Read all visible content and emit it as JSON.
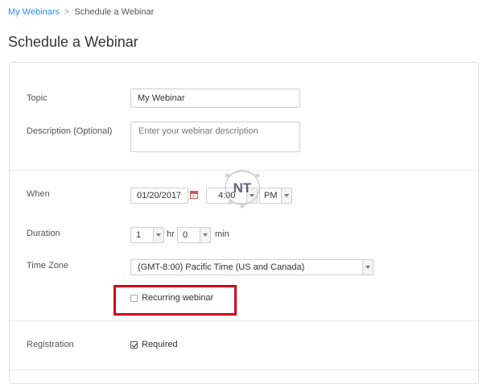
{
  "breadcrumb": {
    "parent": "My Webinars",
    "separator": ">",
    "current": "Schedule a Webinar"
  },
  "page": {
    "title": "Schedule a Webinar"
  },
  "form": {
    "topic": {
      "label": "Topic",
      "value": "My Webinar"
    },
    "description": {
      "label": "Description (Optional)",
      "placeholder": "Enter your webinar description"
    },
    "when": {
      "label": "When",
      "date": "01/20/2017",
      "time": "4:00",
      "ampm": "PM"
    },
    "duration": {
      "label": "Duration",
      "hours": "1",
      "hours_unit": "hr",
      "minutes": "0",
      "minutes_unit": "min"
    },
    "timezone": {
      "label": "Time Zone",
      "value": "(GMT-8:00) Pacific Time (US and Canada)"
    },
    "recurring": {
      "label": "Recurring webinar",
      "checked": false
    },
    "registration": {
      "label": "Registration",
      "option_label": "Required",
      "checked": true
    }
  },
  "watermark": {
    "text": "NT"
  },
  "colors": {
    "link": "#2d8cff",
    "highlight": "#d0021b",
    "calendar_icon": "#d9534f"
  },
  "icons": [
    "calendar-icon",
    "chevron-down-icon",
    "checkbox-icon"
  ]
}
